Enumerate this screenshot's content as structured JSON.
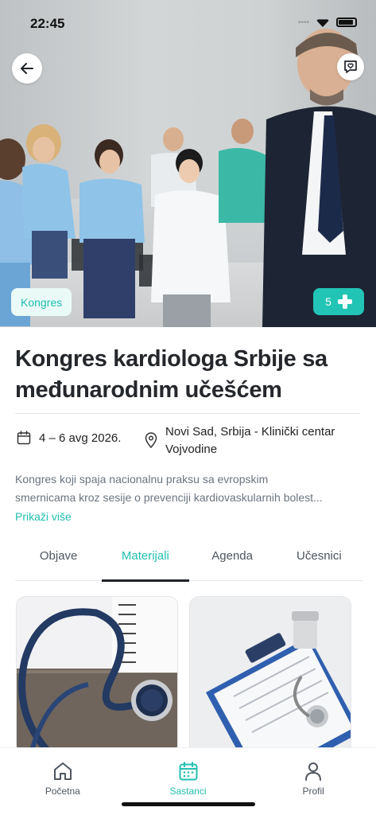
{
  "status_bar": {
    "time": "22:45"
  },
  "hero": {
    "category_chip": "Kongres",
    "participant_count": "5"
  },
  "event": {
    "title": "Kongres kardiologa Srbije sa međunarodnim učešćem",
    "date": "4 – 6 avg 2026.",
    "location": "Novi Sad, Srbija - Klinički centar Vojvodine",
    "description_line1": "Kongres koji spaja nacionalnu praksu sa evropskim",
    "description_line2": "smernicama kroz sesije o prevenciji kardiovaskularnih bolest...",
    "show_more": "Prikaži više"
  },
  "tabs": [
    {
      "label": "Objave"
    },
    {
      "label": "Materijali",
      "active": true
    },
    {
      "label": "Agenda"
    },
    {
      "label": "Učesnici"
    }
  ],
  "bottom_nav": [
    {
      "label": "Početna",
      "icon": "home-icon"
    },
    {
      "label": "Sastanci",
      "icon": "calendar-icon",
      "active": true
    },
    {
      "label": "Profil",
      "icon": "user-icon"
    }
  ],
  "colors": {
    "accent": "#22bfb0",
    "title": "#24272b",
    "muted": "#6b7480"
  }
}
